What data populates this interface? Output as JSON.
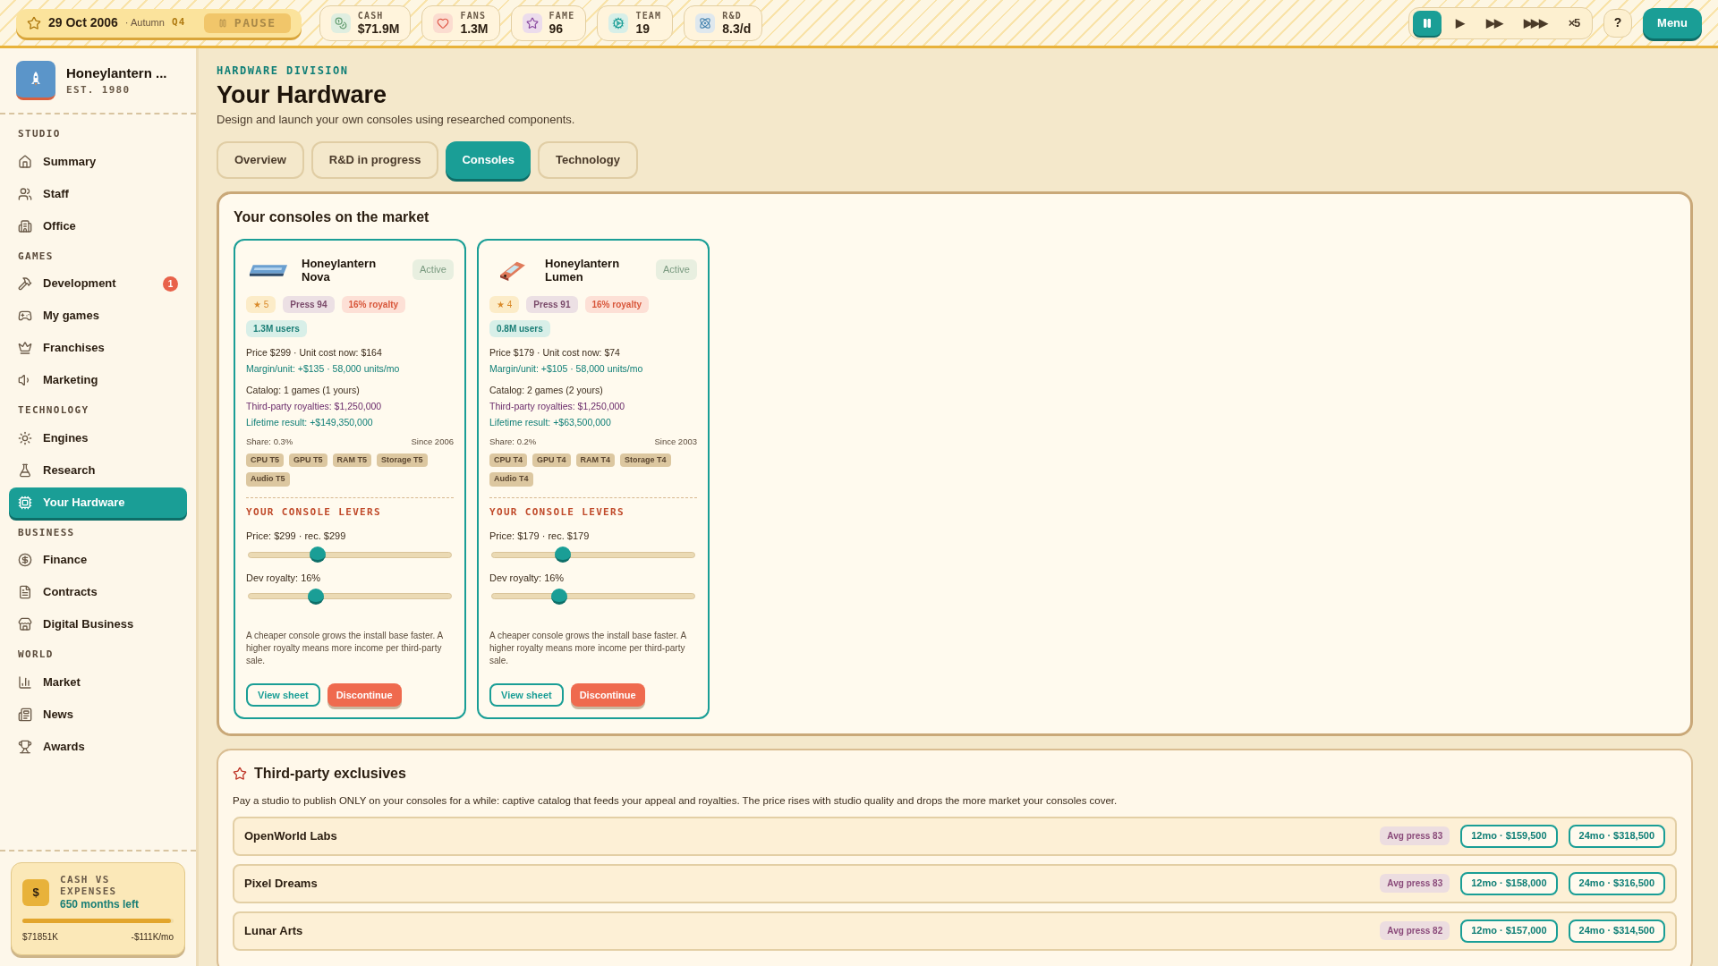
{
  "topbar": {
    "date": "29 Oct 2006",
    "season": "· Autumn",
    "quarter": "Q4",
    "pause_label": "PAUSE",
    "stats": [
      {
        "label": "CASH",
        "value": "$71.9M",
        "color": "#dfeee0"
      },
      {
        "label": "FANS",
        "value": "1.3M",
        "color": "#fbdcd0"
      },
      {
        "label": "FAME",
        "value": "96",
        "color": "#ecdcec"
      },
      {
        "label": "TEAM",
        "value": "19",
        "color": "#d7efe8"
      },
      {
        "label": "R&D",
        "value": "8.3/d",
        "color": "#dfe8ee"
      }
    ],
    "speeds": [
      {
        "kind": "pause",
        "selected": true
      },
      {
        "kind": "glyph",
        "label": "▶",
        "selected": false
      },
      {
        "kind": "glyph",
        "label": "▶▶",
        "selected": false
      },
      {
        "kind": "glyph",
        "label": "▶▶▶",
        "selected": false
      },
      {
        "kind": "glyph",
        "label": "×5",
        "selected": false
      }
    ],
    "help": "?",
    "menu": "Menu"
  },
  "sidebar": {
    "studio_name": "Honeylantern ...",
    "established": "EST. 1980",
    "sections": [
      {
        "title": "STUDIO",
        "items": [
          {
            "label": "Summary",
            "selected": false
          },
          {
            "label": "Staff",
            "selected": false
          },
          {
            "label": "Office",
            "selected": false
          }
        ]
      },
      {
        "title": "GAMES",
        "items": [
          {
            "label": "Development",
            "selected": false,
            "badge": "1"
          },
          {
            "label": "My games",
            "selected": false
          },
          {
            "label": "Franchises",
            "selected": false
          },
          {
            "label": "Marketing",
            "selected": false
          }
        ]
      },
      {
        "title": "TECHNOLOGY",
        "items": [
          {
            "label": "Engines",
            "selected": false
          },
          {
            "label": "Research",
            "selected": false
          },
          {
            "label": "Your Hardware",
            "selected": true
          }
        ]
      },
      {
        "title": "BUSINESS",
        "items": [
          {
            "label": "Finance",
            "selected": false
          },
          {
            "label": "Contracts",
            "selected": false
          },
          {
            "label": "Digital Business",
            "selected": false
          }
        ]
      },
      {
        "title": "WORLD",
        "items": [
          {
            "label": "Market",
            "selected": false
          },
          {
            "label": "News",
            "selected": false
          },
          {
            "label": "Awards",
            "selected": false
          }
        ]
      }
    ],
    "cash_card": {
      "icon": "$",
      "title": "CASH VS EXPENSES",
      "months": "650 months left",
      "level": 0.98,
      "cash": "$71851K",
      "burn": "-$111K/mo"
    }
  },
  "page": {
    "eyebrow": "HARDWARE DIVISION",
    "title": "Your Hardware",
    "subtitle": "Design and launch your own consoles using researched components.",
    "tabs": [
      {
        "label": "Overview",
        "selected": false
      },
      {
        "label": "R&D in progress",
        "selected": false
      },
      {
        "label": "Consoles",
        "selected": true
      },
      {
        "label": "Technology",
        "selected": false
      }
    ]
  },
  "consoles_panel": {
    "title": "Your consoles on the market",
    "consoles": [
      {
        "kind": "home",
        "name": "Honeylantern Nova",
        "status": "Active",
        "stars": "★ 5",
        "press": "Press 94",
        "royalty": "16% royalty",
        "users": "1.3M users",
        "info": [
          [
            {
              "text": "Price $299 · Unit cost now: $164",
              "kind": "plain"
            },
            {
              "text": "Margin/unit: +$135 · 58,000 units/mo",
              "kind": "good"
            }
          ],
          [
            {
              "text": "Catalog: 1 games (1 yours)",
              "kind": "plain"
            },
            {
              "text": "Third-party royalties: $1,250,000",
              "kind": "royalty"
            },
            {
              "text": "Lifetime result: +$149,350,000",
              "kind": "good"
            }
          ]
        ],
        "share": "Share: 0.3%",
        "since": "Since 2006",
        "parts": [
          "CPU T5",
          "GPU T5",
          "RAM T5",
          "Storage T5",
          "Audio T5"
        ],
        "levers_title": "YOUR CONSOLE LEVERS",
        "sliders": [
          {
            "label": "Price: $299 · rec. $299",
            "level": 0.34
          },
          {
            "label": "Dev royalty: 16%",
            "level": 0.33
          }
        ],
        "note": "A cheaper console grows the install base faster. A higher royalty means more income per third-party sale.",
        "view": "View sheet",
        "discontinue": "Discontinue"
      },
      {
        "kind": "handheld",
        "name": "Honeylantern Lumen",
        "status": "Active",
        "stars": "★ 4",
        "press": "Press 91",
        "royalty": "16% royalty",
        "users": "0.8M users",
        "info": [
          [
            {
              "text": "Price $179 · Unit cost now: $74",
              "kind": "plain"
            },
            {
              "text": "Margin/unit: +$105 · 58,000 units/mo",
              "kind": "good"
            }
          ],
          [
            {
              "text": "Catalog: 2 games (2 yours)",
              "kind": "plain"
            },
            {
              "text": "Third-party royalties: $1,250,000",
              "kind": "royalty"
            },
            {
              "text": "Lifetime result: +$63,500,000",
              "kind": "good"
            }
          ]
        ],
        "share": "Share: 0.2%",
        "since": "Since 2003",
        "parts": [
          "CPU T4",
          "GPU T4",
          "RAM T4",
          "Storage T4",
          "Audio T4"
        ],
        "levers_title": "YOUR CONSOLE LEVERS",
        "sliders": [
          {
            "label": "Price: $179 · rec. $179",
            "level": 0.35
          },
          {
            "label": "Dev royalty: 16%",
            "level": 0.33
          }
        ],
        "note": "A cheaper console grows the install base faster. A higher royalty means more income per third-party sale.",
        "view": "View sheet",
        "discontinue": "Discontinue"
      }
    ]
  },
  "exclusives_panel": {
    "title": "Third-party exclusives",
    "description": "Pay a studio to publish ONLY on your consoles for a while: captive catalog that feeds your appeal and royalties. The price rises with studio quality and drops the more market your consoles cover.",
    "studios": [
      {
        "name": "OpenWorld Labs",
        "press": "Avg press 83",
        "offers": [
          "12mo · $159,500",
          "24mo · $318,500"
        ]
      },
      {
        "name": "Pixel Dreams",
        "press": "Avg press 83",
        "offers": [
          "12mo · $158,000",
          "24mo · $316,500"
        ]
      },
      {
        "name": "Lunar Arts",
        "press": "Avg press 82",
        "offers": [
          "12mo · $157,000",
          "24mo · $314,500"
        ]
      }
    ]
  }
}
